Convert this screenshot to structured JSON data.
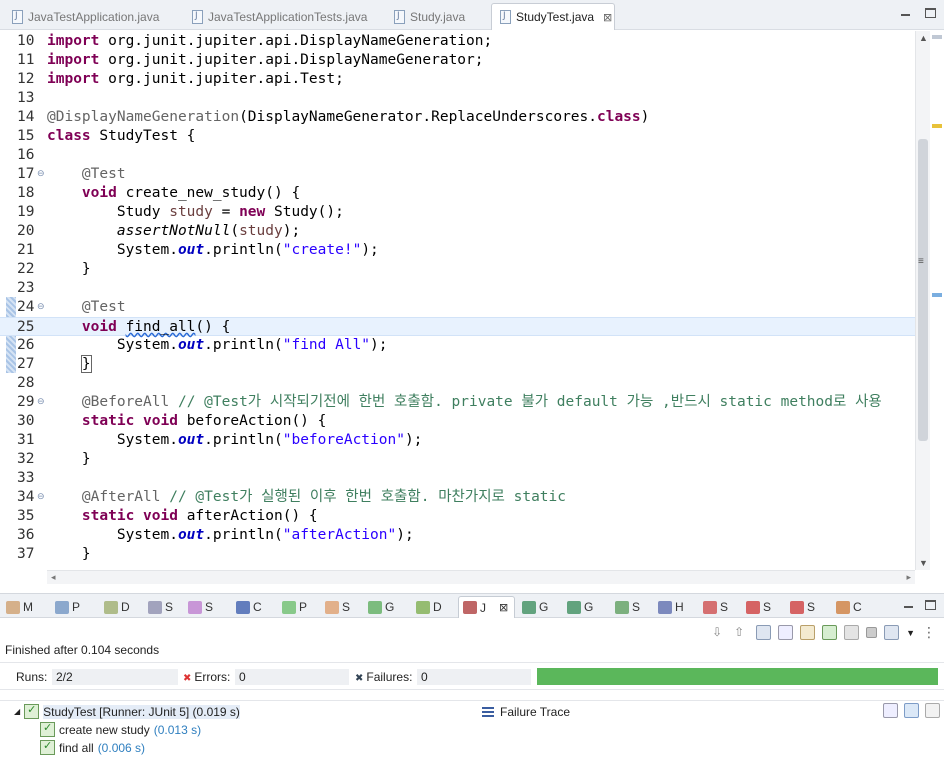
{
  "editor_tabs": [
    {
      "label": "JavaTestApplication.java",
      "active": false
    },
    {
      "label": "JavaTestApplicationTests.java",
      "active": false
    },
    {
      "label": "Study.java",
      "active": false
    },
    {
      "label": "StudyTest.java",
      "active": true
    }
  ],
  "editor_tab_close": "⊠",
  "code_lines": [
    {
      "n": "10",
      "html": "<span class='kw'>import</span> org.junit.jupiter.api.DisplayNameGeneration;"
    },
    {
      "n": "11",
      "html": "<span class='kw'>import</span> org.junit.jupiter.api.DisplayNameGenerator;"
    },
    {
      "n": "12",
      "html": "<span class='kw'>import</span> org.junit.jupiter.api.Test;"
    },
    {
      "n": "13",
      "html": ""
    },
    {
      "n": "14",
      "html": "<span class='ann'>@DisplayNameGeneration</span>(DisplayNameGenerator.ReplaceUnderscores.<span class='kw'>class</span>)"
    },
    {
      "n": "15",
      "html": "<span class='kw'>class</span> StudyTest {"
    },
    {
      "n": "16",
      "html": ""
    },
    {
      "n": "17",
      "fold": true,
      "html": "    <span class='ann'>@Test</span>"
    },
    {
      "n": "18",
      "html": "    <span class='kw'>void</span> create_new_study() {"
    },
    {
      "n": "19",
      "html": "        Study <span class='var'>study</span> = <span class='kw'>new</span> Study();"
    },
    {
      "n": "20",
      "html": "        <span class='stat'>assertNotNull</span>(<span class='var'>study</span>);"
    },
    {
      "n": "21",
      "html": "        System.<span class='fld'>out</span>.println(<span class='str'>\"create!\"</span>);"
    },
    {
      "n": "22",
      "html": "    }"
    },
    {
      "n": "23",
      "html": ""
    },
    {
      "n": "24",
      "fold": true,
      "html": "    <span class='ann'>@Test</span>"
    },
    {
      "n": "25",
      "current": true,
      "html": "    <span class='kw'>void</span> <span class='squig'>find_all</span>() {"
    },
    {
      "n": "26",
      "html": "        System.<span class='fld'>out</span>.println(<span class='str'>\"find All\"</span>);"
    },
    {
      "n": "27",
      "html": "    <span class='brace-box'>}</span>"
    },
    {
      "n": "28",
      "html": ""
    },
    {
      "n": "29",
      "fold": true,
      "html": "    <span class='ann'>@BeforeAll</span> <span class='cmt'>// @Test가 시작되기전에 한번 호출함. private 불가 default 가능 ,반드시 static method로 사용</span>"
    },
    {
      "n": "30",
      "html": "    <span class='kw'>static</span> <span class='kw'>void</span> beforeAction() {"
    },
    {
      "n": "31",
      "html": "        System.<span class='fld'>out</span>.println(<span class='str'>\"beforeAction\"</span>);"
    },
    {
      "n": "32",
      "html": "    }"
    },
    {
      "n": "33",
      "html": ""
    },
    {
      "n": "34",
      "fold": true,
      "html": "    <span class='ann'>@AfterAll</span> <span class='cmt'>// @Test가 실행된 이후 한번 호출함. 마찬가지로 static</span>"
    },
    {
      "n": "35",
      "html": "    <span class='kw'>static</span> <span class='kw'>void</span> afterAction() {"
    },
    {
      "n": "36",
      "html": "        System.<span class='fld'>out</span>.println(<span class='str'>\"afterAction\"</span>);"
    },
    {
      "n": "37",
      "html": "    }"
    }
  ],
  "view_tabs": [
    {
      "label": "M",
      "icon": "markers-icon",
      "color": "#c96"
    },
    {
      "label": "P",
      "icon": "properties-icon",
      "color": "#6a8fbf"
    },
    {
      "label": "D",
      "icon": "data-source-icon",
      "color": "#9a6"
    },
    {
      "label": "S",
      "icon": "snippets-icon",
      "color": "#88a"
    },
    {
      "label": "S",
      "icon": "search-icon",
      "color": "#b7c"
    },
    {
      "label": "C",
      "icon": "console-icon",
      "color": "#35a"
    },
    {
      "label": "P",
      "icon": "progress-icon",
      "color": "#6b6"
    },
    {
      "label": "S",
      "icon": "servers-icon",
      "color": "#d96"
    },
    {
      "label": "G",
      "icon": "gradle-tasks-icon",
      "color": "#5a5"
    },
    {
      "label": "D",
      "icon": "debug-icon",
      "color": "#7a4"
    },
    {
      "label": "J",
      "icon": "junit-icon",
      "color": "#a33",
      "active": true
    },
    {
      "label": "G",
      "icon": "gradle-executions-icon",
      "color": "#385"
    },
    {
      "label": "G",
      "icon": "gradle-elephant-icon",
      "color": "#385"
    },
    {
      "label": "S",
      "icon": "spring-icon",
      "color": "#595"
    },
    {
      "label": "H",
      "icon": "history-icon",
      "color": "#56a"
    },
    {
      "label": "S",
      "icon": "sonar-icon",
      "color": "#c44"
    },
    {
      "label": "S",
      "icon": "stop-icon",
      "color": "#c33"
    },
    {
      "label": "S",
      "icon": "help-icon",
      "color": "#c33"
    },
    {
      "label": "C",
      "icon": "coverage-icon",
      "color": "#c73"
    }
  ],
  "junit": {
    "status": "Finished after 0.104 seconds",
    "runs_label": "Runs:",
    "runs_value": "2/2",
    "errors_label": "Errors:",
    "errors_value": "0",
    "failures_label": "Failures:",
    "failures_value": "0",
    "progress": 1.0,
    "progress_color": "#5bb75b",
    "root": {
      "label": "StudyTest [Runner: JUnit 5] (0.019 s)"
    },
    "tests": [
      {
        "name": "create new study",
        "time": "(0.013 s)"
      },
      {
        "name": "find all",
        "time": "(0.006 s)"
      }
    ],
    "failure_trace_label": "Failure Trace"
  }
}
